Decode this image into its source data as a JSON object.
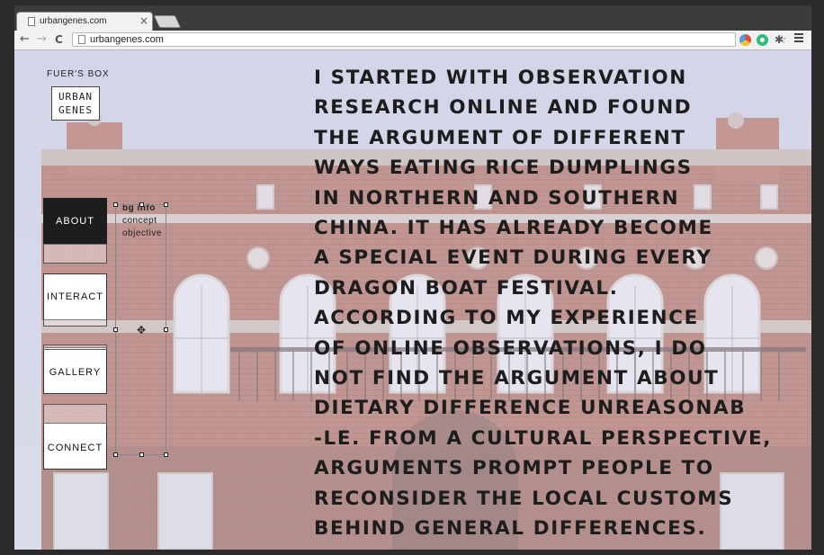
{
  "browser": {
    "tab_title": "urbangenes.com",
    "tab_close": "×",
    "back": "←",
    "forward": "→",
    "reload": "C",
    "url": "urbangenes.com",
    "star": "☆",
    "puzzle": "✱"
  },
  "site": {
    "caption": "FUER'S BOX",
    "logo_lines": [
      "URBAN",
      "GENES"
    ]
  },
  "nav": {
    "items": [
      {
        "label": "ABOUT",
        "active": true
      },
      {
        "label": "INTERACT",
        "active": false
      },
      {
        "label": "GALLERY",
        "active": false
      },
      {
        "label": "CONNECT",
        "active": false
      }
    ],
    "submenu": [
      "bg info",
      "concept",
      "objective"
    ]
  },
  "content": {
    "lines": [
      "I STARTED WITH OBSERVATION",
      "RESEARCH ONLINE AND FOUND",
      "THE ARGUMENT OF DIFFERENT",
      "WAYS EATING RICE DUMPLINGS",
      "IN NORTHERN AND SOUTHERN",
      "CHINA. IT HAS ALREADY BECOME",
      "A SPECIAL EVENT DURING EVERY",
      "DRAGON BOAT FESTIVAL.",
      "ACCORDING TO MY EXPERIENCE",
      "OF ONLINE OBSERVATIONS, I DO",
      "NOT FIND THE ARGUMENT ABOUT",
      "DIETARY DIFFERENCE UNREASONAB",
      "-LE. FROM A CULTURAL PERSPECTIVE,",
      "ARGUMENTS PROMPT PEOPLE TO",
      "RECONSIDER THE LOCAL CUSTOMS",
      "BEHIND GENERAL DIFFERENCES."
    ]
  },
  "colors": {
    "sky": "#d3d6ea",
    "brick": "#a0503e",
    "text": "#1d1d1d",
    "nav_active": "#1d1d1d"
  }
}
